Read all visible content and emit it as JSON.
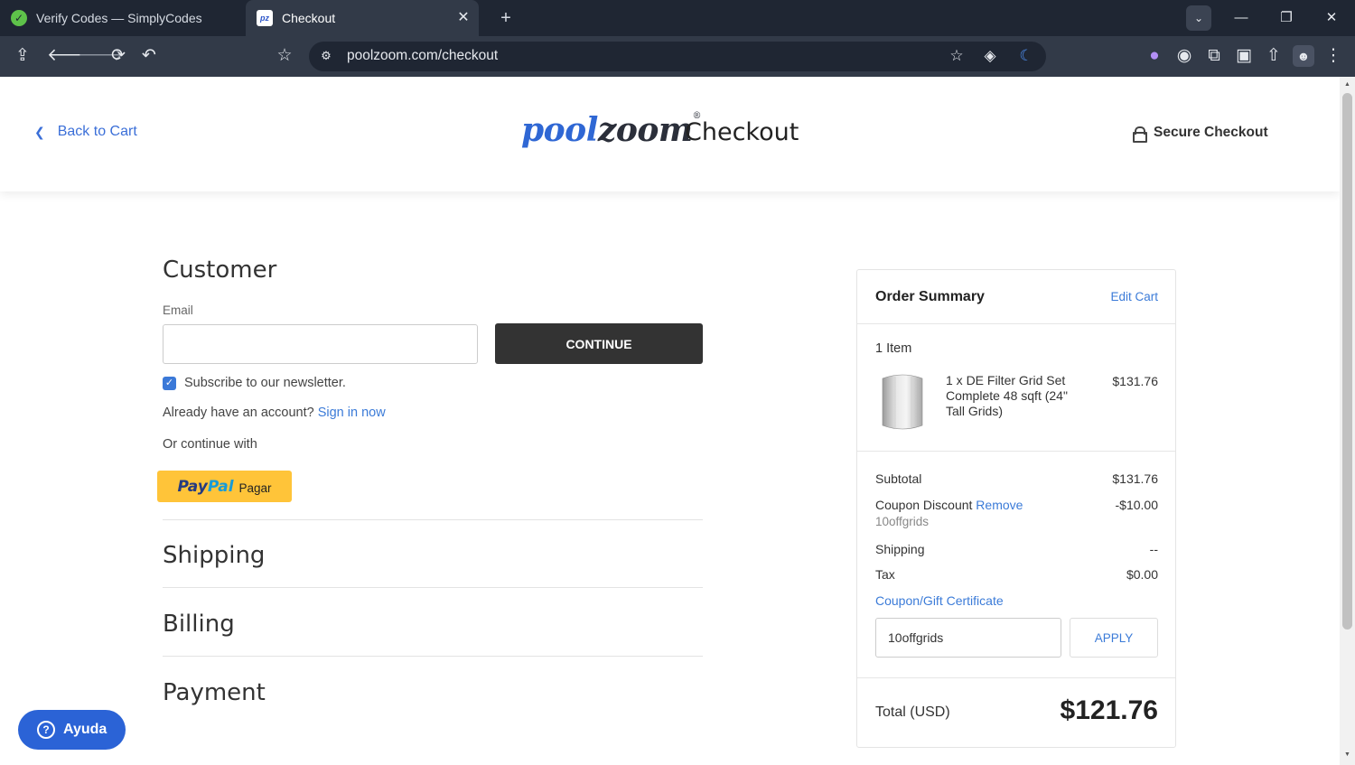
{
  "browser": {
    "tabs": [
      {
        "title": "Verify Codes — SimplyCodes",
        "icon": "simplycodes-favicon"
      },
      {
        "title": "Checkout",
        "icon": "poolzoom-favicon",
        "favicon_text": "pz"
      }
    ],
    "url": "poolzoom.com/checkout"
  },
  "header": {
    "back_label": "Back to Cart",
    "logo_pool": "pool",
    "logo_zoom": "zoom",
    "logo_tm": "®",
    "title": "Checkout",
    "secure_label": "Secure Checkout"
  },
  "customer": {
    "title": "Customer",
    "email_label": "Email",
    "email_value": "",
    "continue_label": "CONTINUE",
    "newsletter_label": "Subscribe to our newsletter.",
    "newsletter_checked": true,
    "account_prompt": "Already have an account?",
    "sign_in_label": "Sign in now",
    "continue_with": "Or continue with",
    "paypal_pay": "Pay",
    "paypal_pal": "Pal",
    "paypal_label": "Pagar"
  },
  "sections": {
    "shipping": "Shipping",
    "billing": "Billing",
    "payment": "Payment"
  },
  "summary": {
    "title": "Order Summary",
    "edit_cart": "Edit Cart",
    "item_count": "1 Item",
    "item_name": "1 x DE Filter Grid Set Complete 48 sqft (24\" Tall Grids)",
    "item_price": "$131.76",
    "subtotal_label": "Subtotal",
    "subtotal_value": "$131.76",
    "discount_label": "Coupon Discount",
    "remove_label": "Remove",
    "discount_value": "-$10.00",
    "coupon_code": "10offgrids",
    "shipping_label": "Shipping",
    "shipping_value": "--",
    "tax_label": "Tax",
    "tax_value": "$0.00",
    "coupon_link": "Coupon/Gift Certificate",
    "coupon_input_value": "10offgrids",
    "apply_label": "APPLY",
    "total_label": "Total (USD)",
    "total_value": "$121.76"
  },
  "help": {
    "label": "Ayuda"
  },
  "colors": {
    "accent_blue": "#3b7bd8",
    "dark_button": "#333333",
    "paypal_yellow": "#ffc439",
    "help_blue": "#2b63d6"
  }
}
